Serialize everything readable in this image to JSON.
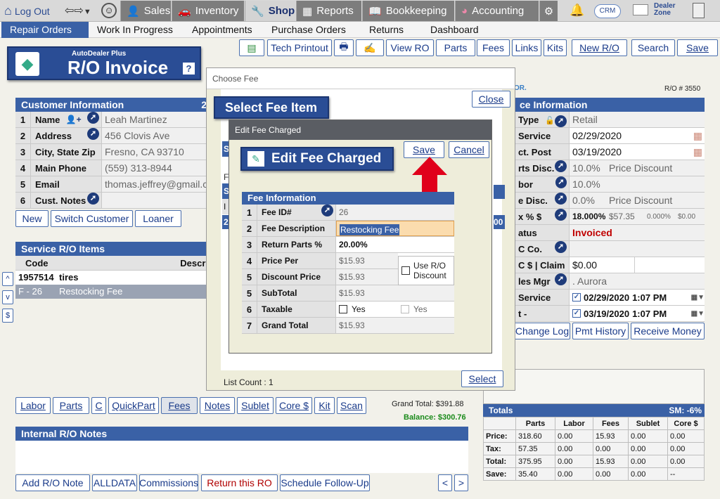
{
  "topbar": {
    "logout": "Log Out",
    "nav": [
      {
        "label": "Sales"
      },
      {
        "label": "Inventory"
      },
      {
        "label": "Shop"
      },
      {
        "label": "Reports"
      },
      {
        "label": "Bookkeeping"
      },
      {
        "label": "Accounting"
      }
    ],
    "crm": "CRM",
    "dealer_zone": [
      "Dealer",
      "Zone"
    ]
  },
  "subnav": [
    "Repair Orders",
    "Work In Progress",
    "Appointments",
    "Purchase Orders",
    "Returns",
    "Dashboard"
  ],
  "toolbar": [
    "Tech Printout",
    "View RO",
    "Parts",
    "Fees",
    "Links",
    "Kits",
    "New R/O",
    "Search",
    "Save"
  ],
  "logo": {
    "brand": "AutoDealer Plus",
    "title": "R/O Invoice",
    "help": "?"
  },
  "customer": {
    "header": "Customer Information",
    "header_suffix": "2",
    "rows": [
      {
        "n": "1",
        "label": "Name",
        "value": "Leah Martinez"
      },
      {
        "n": "2",
        "label": "Address",
        "value": "456 Clovis Ave"
      },
      {
        "n": "3",
        "label": "City, State Zip",
        "value": "Fresno, CA 93710"
      },
      {
        "n": "4",
        "label": "Main Phone",
        "value": "(559) 313-8944"
      },
      {
        "n": "5",
        "label": "Email",
        "value": "thomas.jeffrey@gmail.c"
      },
      {
        "n": "6",
        "label": "Cust. Notes",
        "value": ""
      }
    ],
    "buttons": [
      "New",
      "Switch Customer",
      "Loaner"
    ]
  },
  "service_items": {
    "header": "Service R/O Items",
    "cols": [
      "Code",
      "Descri"
    ],
    "rows": [
      {
        "code": "1957514",
        "desc": "tires"
      },
      {
        "code": "F - 26",
        "desc": "Restocking Fee"
      }
    ],
    "side_buttons": [
      "^",
      "v",
      "$"
    ]
  },
  "bottom_buttons": [
    "Labor",
    "Parts",
    "C",
    "QuickPart",
    "Fees",
    "Notes",
    "Sublet",
    "Core $",
    "Kit",
    "Scan"
  ],
  "grand_total": "Grand Total: $391.88",
  "balance": "Balance: $300.76",
  "notes": {
    "header": "Internal R/O Notes"
  },
  "footer_buttons": [
    "Add R/O Note",
    "ALLDATA",
    "Commissions",
    "Return this RO",
    "Schedule Follow-Up",
    "<",
    ">"
  ],
  "right": {
    "ro_num": "R/O # 3550",
    "brand_fragment": "OR.",
    "header": "ce Information",
    "rows": [
      {
        "label": "Type",
        "value": "Retail"
      },
      {
        "label": "Service Date",
        "value": "02/29/2020"
      },
      {
        "label": "ct. Post Date",
        "value": "03/19/2020"
      },
      {
        "label": "rts Disc.",
        "value": "10.0%",
        "extra": "Price Discount"
      },
      {
        "label": "bor Disc.",
        "value": "10.0%"
      },
      {
        "label": "e Disc.",
        "value": "0.0%",
        "extra": "Price Discount"
      },
      {
        "label": "x % $",
        "value": "18.000%",
        "extra": "$57.35",
        "e2": "0.000%",
        "e3": "$0.00"
      },
      {
        "label": "atus",
        "value": "Invoiced"
      },
      {
        "label": "C Co.",
        "value": ""
      },
      {
        "label": "C $ | Claim #",
        "value": "$0.00"
      },
      {
        "label": "les Mgr",
        "value": ". Aurora"
      },
      {
        "label": "Service",
        "value": "02/29/2020",
        "time": "1:07 PM"
      },
      {
        "label": "t - Complete",
        "value": "03/19/2020",
        "time": "1:07 PM"
      }
    ],
    "buttons": [
      "Change Log",
      "Pmt History",
      "Receive Money"
    ]
  },
  "totals": {
    "header": "Totals",
    "sm": "SM: -6%",
    "cols": [
      "Parts",
      "Labor",
      "Fees",
      "Sublet",
      "Core $"
    ],
    "rows": [
      {
        "label": "Price:",
        "vals": [
          "318.60",
          "0.00",
          "15.93",
          "0.00",
          "0.00"
        ]
      },
      {
        "label": "Tax:",
        "vals": [
          "57.35",
          "0.00",
          "0.00",
          "0.00",
          "0.00"
        ]
      },
      {
        "label": "Total:",
        "vals": [
          "375.95",
          "0.00",
          "15.93",
          "0.00",
          "0.00"
        ]
      },
      {
        "label": "Save:",
        "vals": [
          "35.40",
          "0.00",
          "0.00",
          "0.00",
          "--"
        ]
      }
    ]
  },
  "choose_fee": {
    "title": "Choose Fee",
    "close": "Close",
    "heading": "Select Fee Item",
    "list_count": "List Count : 1",
    "select": "Select",
    "frag_s": "S",
    "frag_f": "F",
    "frag_i": "I",
    "frag_2": "2",
    "frag_00": "00"
  },
  "edit_fee": {
    "title": "Edit Fee Charged",
    "heading": "Edit Fee Charged",
    "save": "Save",
    "cancel": "Cancel",
    "info_header": "Fee Information",
    "rows": [
      {
        "n": "1",
        "label": "Fee ID#",
        "value": "26"
      },
      {
        "n": "2",
        "label": "Fee Description",
        "value": "Restocking Fee"
      },
      {
        "n": "3",
        "label": "Return Parts %",
        "value": "20.00%"
      },
      {
        "n": "4",
        "label": "Price Per",
        "value": "$15.93"
      },
      {
        "n": "5",
        "label": "Discount Price",
        "value": "$15.93"
      },
      {
        "n": "5",
        "label": "SubTotal",
        "value": "$15.93"
      },
      {
        "n": "6",
        "label": "Taxable",
        "value": "Yes",
        "extra": "Yes"
      },
      {
        "n": "7",
        "label": "Grand Total",
        "value": "$15.93"
      }
    ],
    "use_ro_discount": [
      "Use R/O",
      "Discount"
    ]
  }
}
